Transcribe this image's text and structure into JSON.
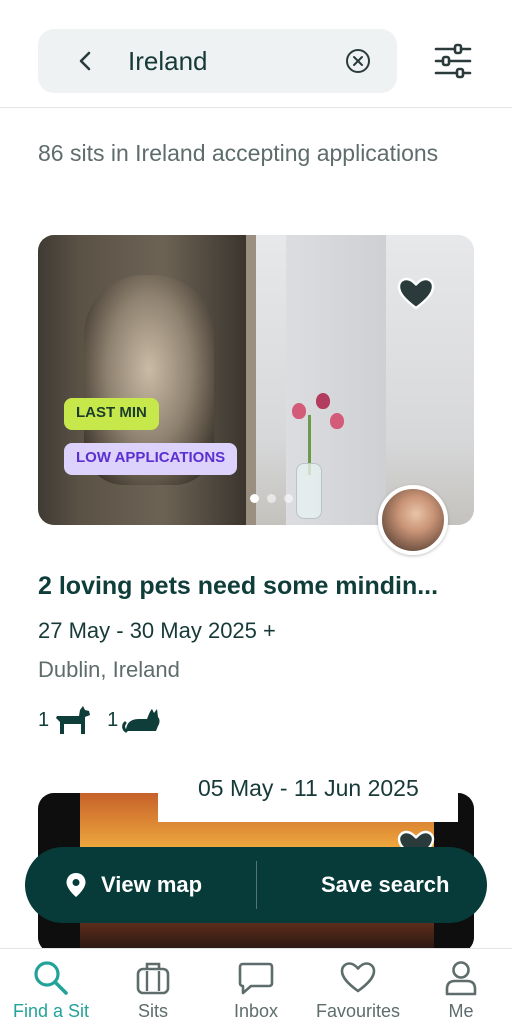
{
  "search": {
    "query": "Ireland",
    "back_icon": "chevron-left-icon",
    "clear_icon": "clear-circle-icon",
    "filter_icon": "sliders-icon"
  },
  "results_summary": "86 sits in Ireland accepting applications",
  "listings": [
    {
      "title": "2 loving pets need some mindin...",
      "dates": "27 May - 30 May 2025 +",
      "location": "Dublin, Ireland",
      "badges": [
        "LAST MIN",
        "LOW APPLICATIONS"
      ],
      "pets": [
        {
          "count": "1",
          "icon": "dog-icon"
        },
        {
          "count": "1",
          "icon": "cat-icon"
        }
      ],
      "favourite_icon": "heart-icon",
      "carousel": {
        "total": 3,
        "active": 1
      }
    },
    {
      "dates": "05 May - 11 Jun 2025",
      "favourite_icon": "heart-icon"
    }
  ],
  "actions": {
    "view_map": "View map",
    "save_search": "Save search"
  },
  "tabs": [
    {
      "label": "Find a Sit",
      "icon": "search-icon",
      "active": true
    },
    {
      "label": "Sits",
      "icon": "suitcase-icon",
      "active": false
    },
    {
      "label": "Inbox",
      "icon": "chat-icon",
      "active": false
    },
    {
      "label": "Favourites",
      "icon": "heart-icon",
      "active": false
    },
    {
      "label": "Me",
      "icon": "user-icon",
      "active": false
    }
  ],
  "colors": {
    "primary": "#063b3a",
    "accent": "#22a39a",
    "badge_lastmin": "#c6e84b",
    "badge_lowapp_bg": "#dcd2fb",
    "badge_lowapp_text": "#5b2fd2"
  }
}
